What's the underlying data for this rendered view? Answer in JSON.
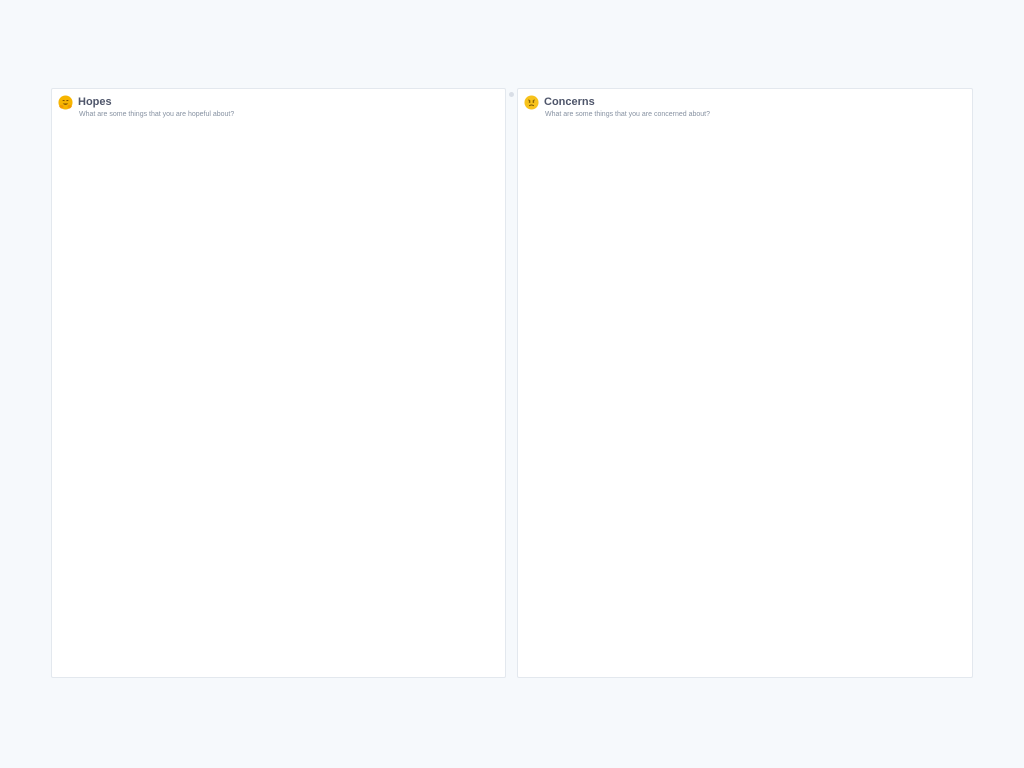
{
  "columns": [
    {
      "title": "Hopes",
      "subtitle": "What are some things that you are hopeful about?",
      "icon": "hugging-face-emoji-icon",
      "accent": "#f5a623"
    },
    {
      "title": "Concerns",
      "subtitle": "What are some things that you are concerned about?",
      "icon": "worried-face-emoji-icon",
      "accent": "#f5b50a"
    }
  ],
  "colors": {
    "page_background": "#f6f9fc",
    "column_background": "#ffffff",
    "border": "#e3e8ee",
    "title": "#4f566b",
    "subtitle": "#8792a2"
  }
}
